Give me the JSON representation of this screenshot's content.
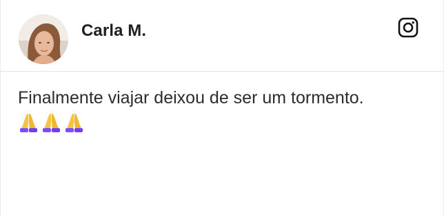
{
  "post": {
    "author": "Carla M.",
    "platform_icon": "instagram-icon",
    "text": "Finalmente viajar deixou de ser um tormento.",
    "emojis": [
      "folded-hands-emoji",
      "folded-hands-emoji",
      "folded-hands-emoji"
    ]
  },
  "colors": {
    "text": "#2c2c2c",
    "author": "#1f1f1f",
    "divider": "#e3e3e3",
    "emoji_sleeve": "#7c4dff",
    "emoji_hands": "#f6c244"
  }
}
